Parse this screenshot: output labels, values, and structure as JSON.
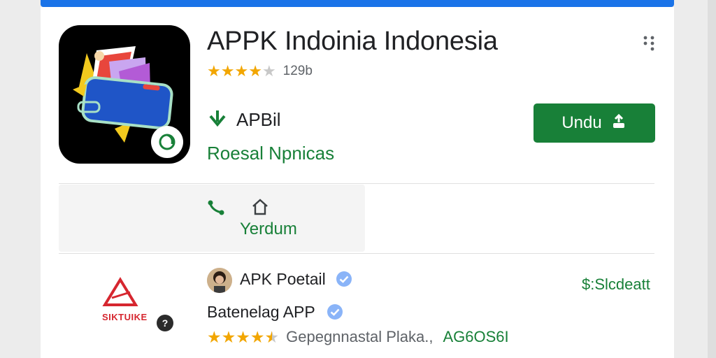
{
  "header": {
    "title": "APPK Indoinia Indonesia",
    "stars_filled": 4,
    "stars_total": 5,
    "rating_count": "129b"
  },
  "developer": {
    "name": "APBil",
    "category": "Roesal Npnicas"
  },
  "install": {
    "label": "Undu"
  },
  "actions": {
    "label": "Yerdum"
  },
  "related": {
    "logo_text": "SIKTUIKE",
    "developer_name": "APK Poetail",
    "price": "$:Slcdeatt",
    "app_name": "Batenelag APP",
    "stars_filled": 4.5,
    "meta_text": "Gepegnnastal Plaka.,",
    "meta_code": "AG6OS6I"
  },
  "colors": {
    "accent": "#1a73e8",
    "primary_green": "#188038",
    "star": "#f2a600",
    "logo_red": "#d6262f"
  },
  "icons": [
    "more-vert-icon",
    "download-arrow-icon",
    "download-icon",
    "share-icon",
    "wishlist-icon",
    "help-icon",
    "verified-icon"
  ]
}
